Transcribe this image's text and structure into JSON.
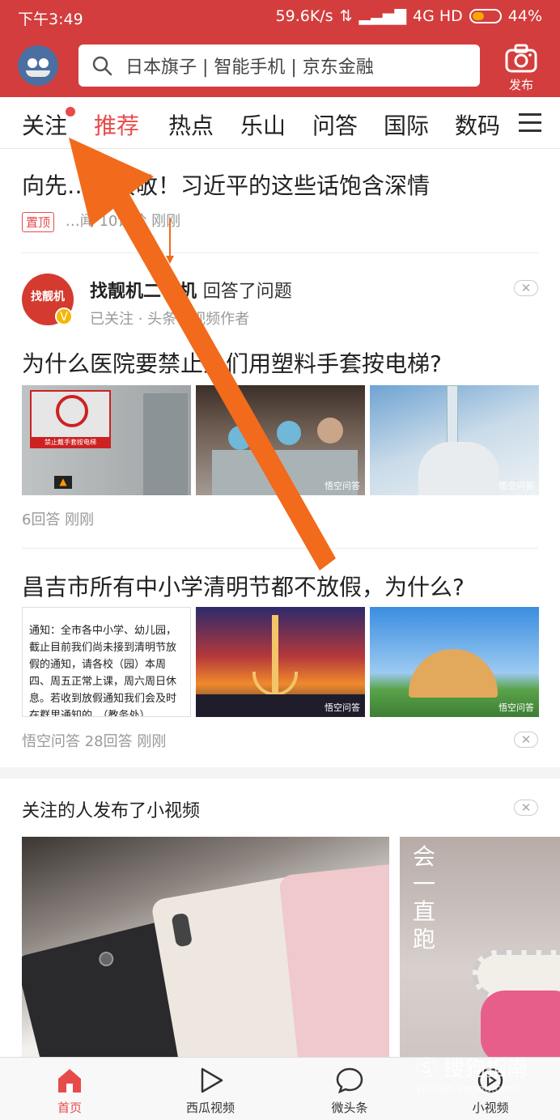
{
  "status_bar": {
    "time": "下午3:49",
    "net_speed": "59.6K/s",
    "network": "4G HD",
    "battery": "44%",
    "battery_level": 0.44
  },
  "header": {
    "search_placeholder": "日本旗子 | 智能手机 | 京东金融",
    "publish_label": "发布"
  },
  "tabs": [
    {
      "label": "关注",
      "has_dot": true
    },
    {
      "label": "推荐",
      "active": true
    },
    {
      "label": "热点"
    },
    {
      "label": "乐山"
    },
    {
      "label": "问答"
    },
    {
      "label": "国际"
    },
    {
      "label": "数码"
    }
  ],
  "feed": {
    "item1": {
      "title": "向先……致敬！习近平的这些话饱含深情",
      "tag": "置顶",
      "meta": "…闻 10评论 刚刚"
    },
    "item2": {
      "author_avatar_text": "找靓机",
      "author": "找靓机二手机",
      "action": "回答了问题",
      "author_sub": "已关注 · 头条号视频作者",
      "title": "为什么医院要禁止人们用塑料手套按电梯?",
      "meta": "6回答 刚刚",
      "thumb1_sign": "禁止戴手套按电梯",
      "watermark": "悟空问答"
    },
    "item3": {
      "title": "昌吉市所有中小学清明节都不放假，为什么?",
      "notice_text": "通知：全市各中小学、幼儿园，截止目前我们尚未接到清明节放假的通知，请各校（园）本周四、周五正常上课，周六周日休息。若收到放假通知我们会及时在群里通知的。（教务处）",
      "meta": "悟空问答 28回答 刚刚",
      "watermark": "悟空问答"
    },
    "video_section": {
      "title": "关注的人发布了小视频",
      "video2_caption": "会一直跑"
    }
  },
  "bottom_nav": [
    {
      "label": "首页",
      "icon": "home-icon",
      "active": true
    },
    {
      "label": "西瓜视频",
      "icon": "play-icon"
    },
    {
      "label": "微头条",
      "icon": "chat-bubble-icon"
    },
    {
      "label": "小视频",
      "icon": "mini-video-icon"
    }
  ],
  "watermark": {
    "text": "搜狗指南",
    "url": "zhinan.sogou.com"
  },
  "colors": {
    "brand_red": "#d43d3d",
    "accent_red": "#e84a4a",
    "annotation_arrow": "#f26a1b"
  }
}
